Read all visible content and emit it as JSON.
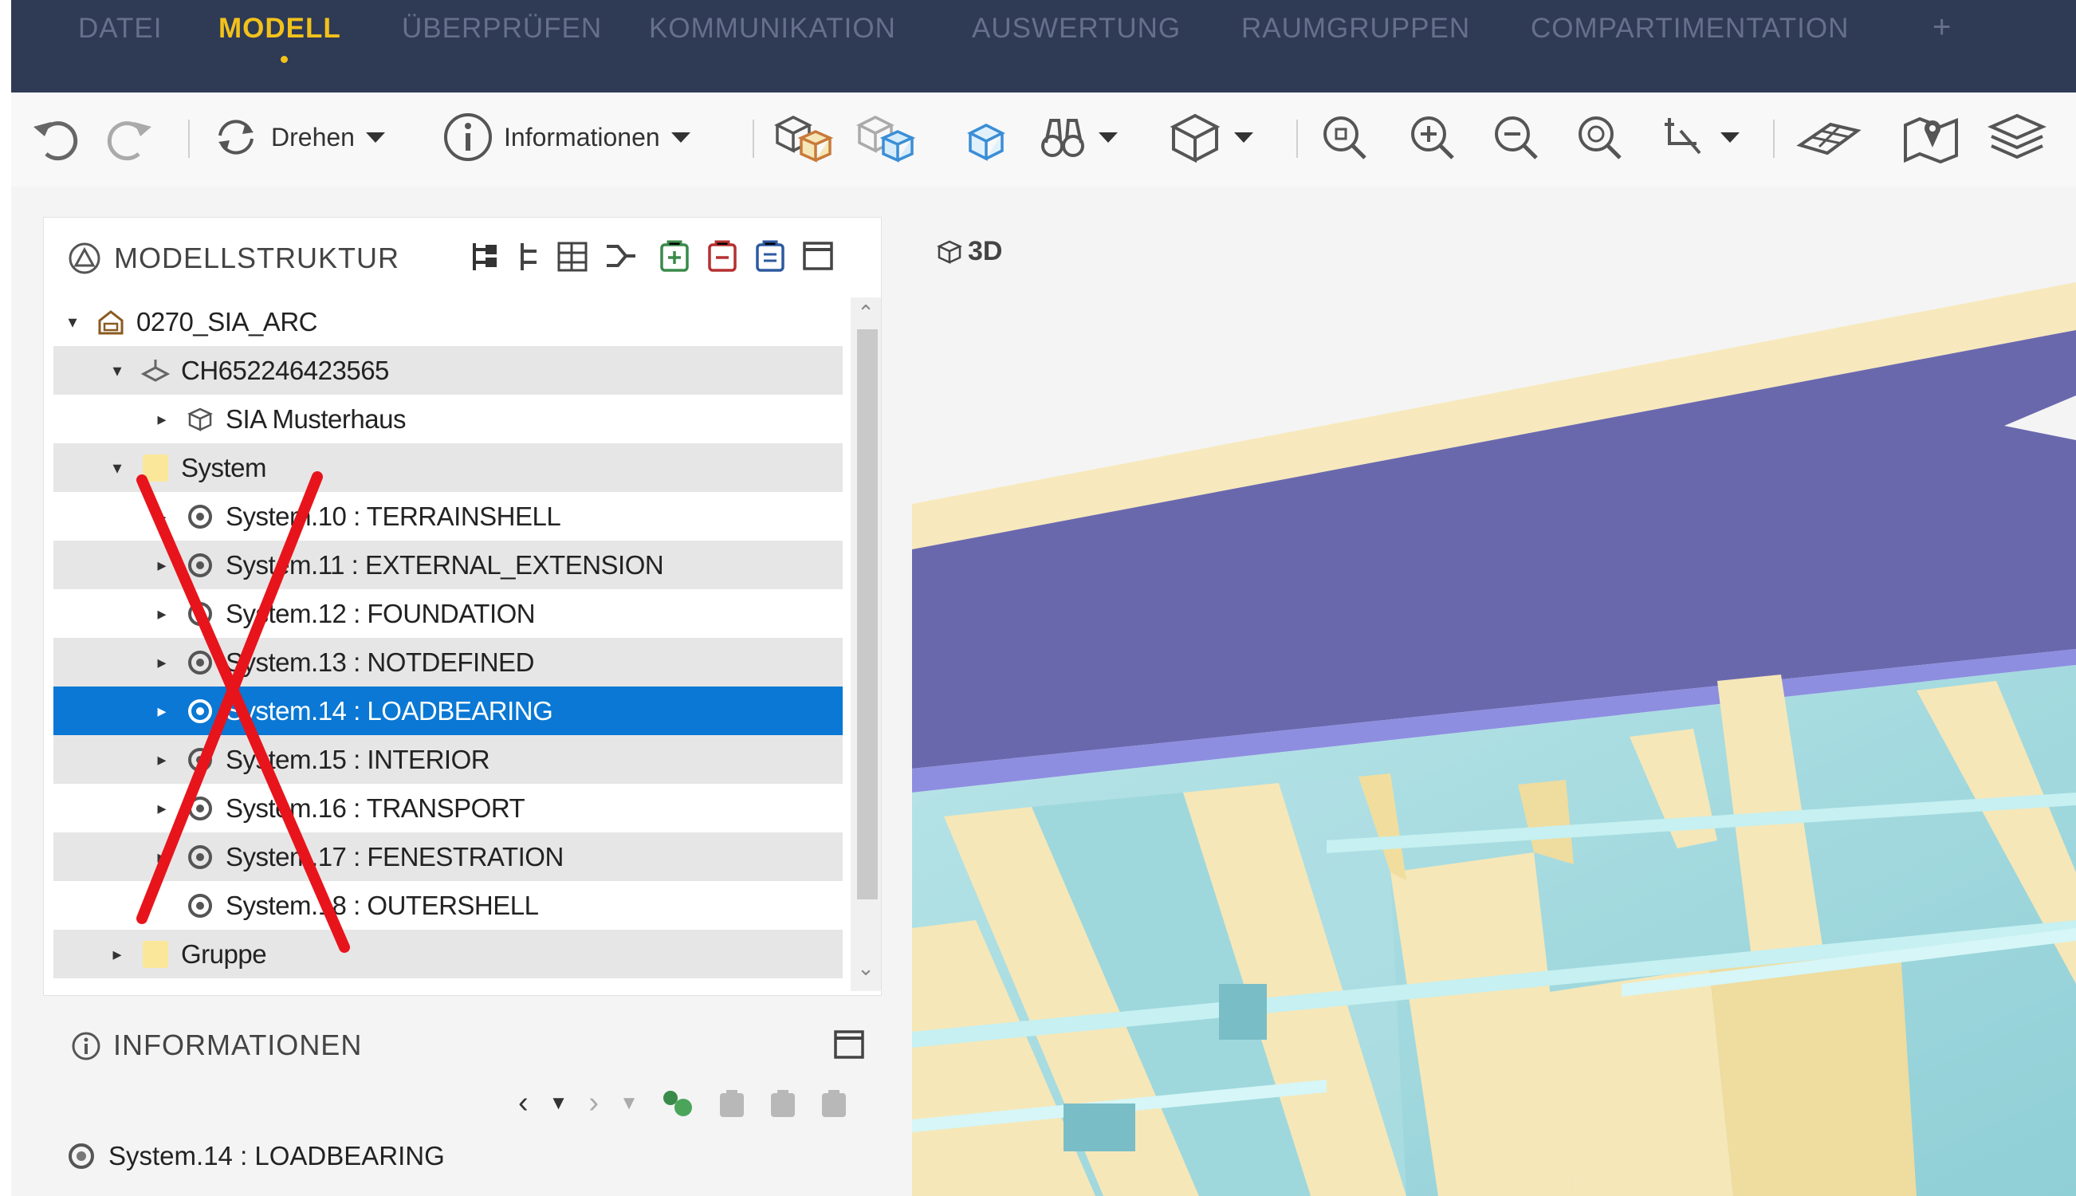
{
  "menu": {
    "items": [
      "DATEI",
      "MODELL",
      "ÜBERPRÜFEN",
      "KOMMUNIKATION",
      "AUSWERTUNG",
      "RAUMGRUPPEN",
      "COMPARTIMENTATION"
    ],
    "active": "MODELL",
    "add": "+"
  },
  "toolbar": {
    "rotate_label": "Drehen",
    "info_label": "Informationen"
  },
  "model_structure": {
    "title": "MODELLSTRUKTUR",
    "rows": [
      {
        "label": "0270_SIA_ARC",
        "indent": 0,
        "expanded": true,
        "icon": "building-icon"
      },
      {
        "label": "CH652246423565",
        "indent": 1,
        "expanded": true,
        "icon": "site-icon"
      },
      {
        "label": "SIA Musterhaus",
        "indent": 2,
        "expanded": false,
        "icon": "cube-icon"
      },
      {
        "label": "System",
        "indent": 1,
        "expanded": true,
        "icon": "folder-icon"
      },
      {
        "label": "System.10 : TERRAINSHELL",
        "indent": 2,
        "expanded": false,
        "icon": "system-icon"
      },
      {
        "label": "System.11 : EXTERNAL_EXTENSION",
        "indent": 2,
        "expanded": false,
        "icon": "system-icon"
      },
      {
        "label": "System.12 : FOUNDATION",
        "indent": 2,
        "expanded": false,
        "icon": "system-icon"
      },
      {
        "label": "System.13 : NOTDEFINED",
        "indent": 2,
        "expanded": false,
        "icon": "system-icon"
      },
      {
        "label": "System.14 : LOADBEARING",
        "indent": 2,
        "expanded": false,
        "icon": "system-icon",
        "selected": true
      },
      {
        "label": "System.15 : INTERIOR",
        "indent": 2,
        "expanded": false,
        "icon": "system-icon"
      },
      {
        "label": "System.16 : TRANSPORT",
        "indent": 2,
        "expanded": false,
        "icon": "system-icon"
      },
      {
        "label": "System.17 : FENESTRATION",
        "indent": 2,
        "expanded": false,
        "icon": "system-icon"
      },
      {
        "label": "System.18 : OUTERSHELL",
        "indent": 2,
        "expanded": null,
        "icon": "system-icon"
      },
      {
        "label": "Gruppe",
        "indent": 1,
        "expanded": false,
        "icon": "folder-icon"
      }
    ]
  },
  "information": {
    "title": "INFORMATIONEN",
    "selected_item": "System.14 : LOADBEARING"
  },
  "view": {
    "label": "3D"
  },
  "colors": {
    "menubar": "#2f3a55",
    "menu_active": "#f2c21b",
    "selection": "#0a78d4",
    "roof": "#6a68ad",
    "beams": "#f6e7b8",
    "walls": "#a8dce0",
    "annotation": "#e8141c"
  }
}
